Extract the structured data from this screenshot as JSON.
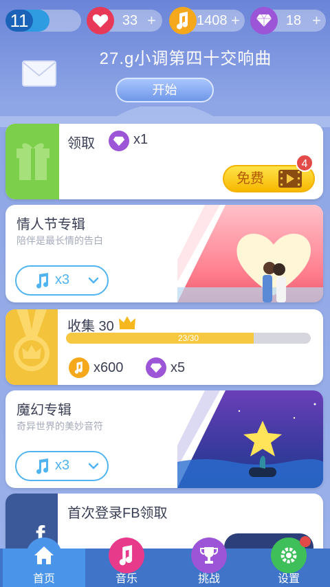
{
  "topbar": {
    "level": "11",
    "hearts": "33",
    "notes": "1408",
    "gems": "18",
    "plus": "+"
  },
  "hero": {
    "song_title": "27.g小调第四十交响曲",
    "start_label": "开始"
  },
  "gift": {
    "title": "领取",
    "reward_qty": "x1",
    "free_label": "免费",
    "badge": "4"
  },
  "valentine": {
    "title": "情人节专辑",
    "subtitle": "陪伴是最长情的告白",
    "select_value": "x3"
  },
  "collect": {
    "title": "收集 30",
    "progress_text": "23/30",
    "progress_fraction": 0.767,
    "reward_notes": "x600",
    "reward_gems": "x5"
  },
  "fantasy": {
    "title": "魔幻专辑",
    "subtitle": "奇异世界的美妙音符",
    "select_value": "x3"
  },
  "fb": {
    "title": "首次登录FB领取"
  },
  "nav": {
    "home": "首页",
    "music": "音乐",
    "challenge": "挑战",
    "settings": "设置"
  },
  "colors": {
    "accent": "#4fb4f0",
    "gift_green": "#7bcf4b",
    "gold": "#f6c842",
    "heart": "#e83a58",
    "note": "#f5a81c",
    "gem": "#9b55d6"
  }
}
